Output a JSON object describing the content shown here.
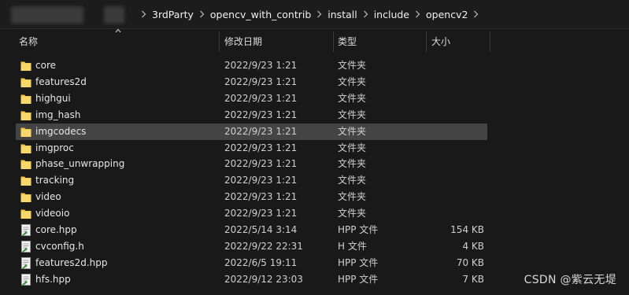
{
  "breadcrumb": [
    "3rdParty",
    "opencv_with_contrib",
    "install",
    "include",
    "opencv2"
  ],
  "columns": {
    "name": "名称",
    "date": "修改日期",
    "type": "类型",
    "size": "大小"
  },
  "rows": [
    {
      "name": "core",
      "date": "2022/9/23 1:21",
      "type": "文件夹",
      "size": "",
      "icon": "folder-icon"
    },
    {
      "name": "features2d",
      "date": "2022/9/23 1:21",
      "type": "文件夹",
      "size": "",
      "icon": "folder-icon"
    },
    {
      "name": "highgui",
      "date": "2022/9/23 1:21",
      "type": "文件夹",
      "size": "",
      "icon": "folder-icon"
    },
    {
      "name": "img_hash",
      "date": "2022/9/23 1:21",
      "type": "文件夹",
      "size": "",
      "icon": "folder-icon"
    },
    {
      "name": "imgcodecs",
      "date": "2022/9/23 1:21",
      "type": "文件夹",
      "size": "",
      "icon": "folder-icon",
      "selected": true
    },
    {
      "name": "imgproc",
      "date": "2022/9/23 1:21",
      "type": "文件夹",
      "size": "",
      "icon": "folder-icon"
    },
    {
      "name": "phase_unwrapping",
      "date": "2022/9/23 1:21",
      "type": "文件夹",
      "size": "",
      "icon": "folder-icon"
    },
    {
      "name": "tracking",
      "date": "2022/9/23 1:21",
      "type": "文件夹",
      "size": "",
      "icon": "folder-icon"
    },
    {
      "name": "video",
      "date": "2022/9/23 1:21",
      "type": "文件夹",
      "size": "",
      "icon": "folder-icon"
    },
    {
      "name": "videoio",
      "date": "2022/9/23 1:21",
      "type": "文件夹",
      "size": "",
      "icon": "folder-icon"
    },
    {
      "name": "core.hpp",
      "date": "2022/5/14 3:14",
      "type": "HPP 文件",
      "size": "154 KB",
      "icon": "file-icon"
    },
    {
      "name": "cvconfig.h",
      "date": "2022/9/22 22:31",
      "type": "H 文件",
      "size": "4 KB",
      "icon": "file-icon"
    },
    {
      "name": "features2d.hpp",
      "date": "2022/6/5 19:11",
      "type": "HPP 文件",
      "size": "70 KB",
      "icon": "file-icon"
    },
    {
      "name": "hfs.hpp",
      "date": "2022/9/12 23:03",
      "type": "HPP 文件",
      "size": "7 KB",
      "icon": "file-icon"
    }
  ],
  "watermark": "CSDN @紫云无堤",
  "colors": {
    "background": "#191919",
    "selected_row": "#444444",
    "folder": "#f3c948"
  }
}
